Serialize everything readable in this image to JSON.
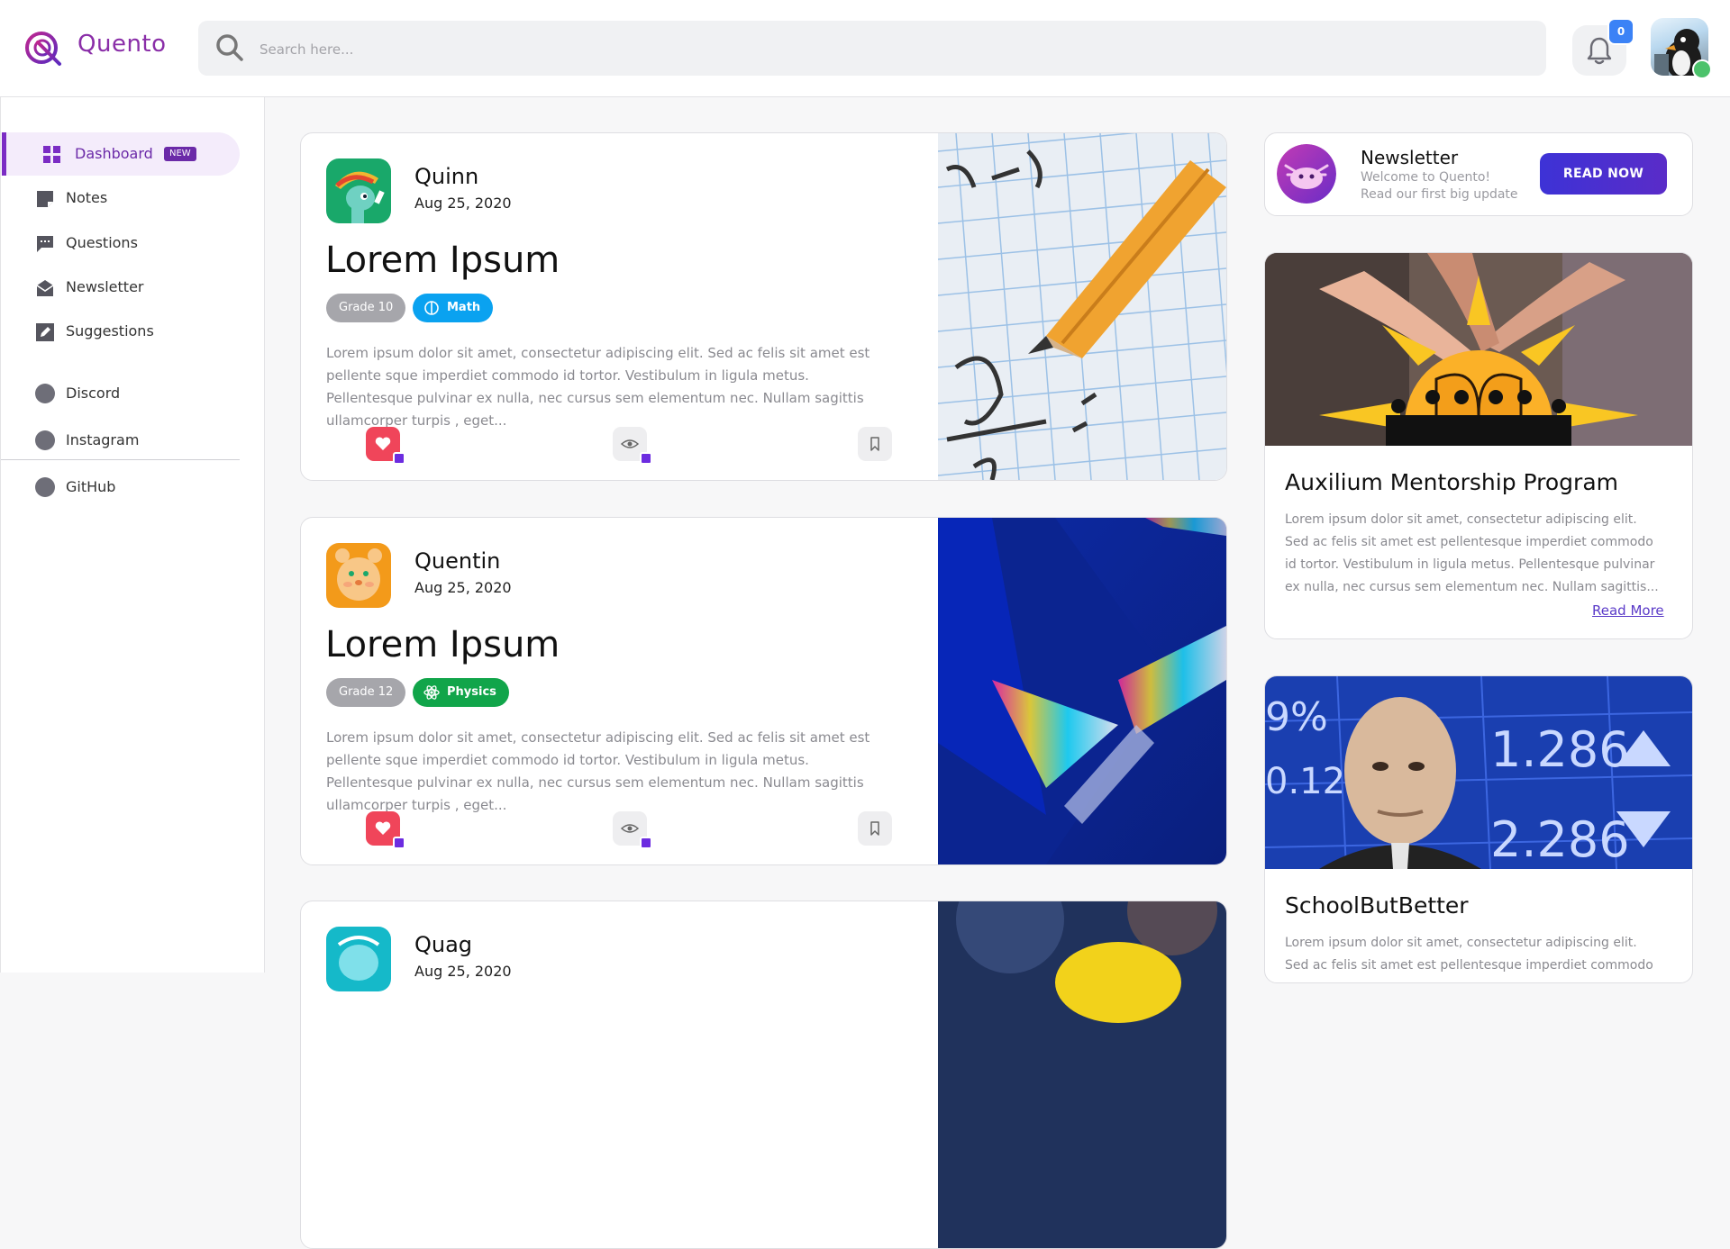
{
  "app": {
    "name": "Quento",
    "brand_color": "#8a2ea8",
    "search_placeholder": "Search here...",
    "notification_count": "0"
  },
  "sidebar": {
    "items": [
      {
        "label": "Dashboard",
        "icon": "dashboard-grid-icon",
        "badge": "NEW",
        "active": true
      },
      {
        "label": "Notes",
        "icon": "note-icon"
      },
      {
        "label": "Questions",
        "icon": "chat-bubble-icon"
      },
      {
        "label": "Newsletter",
        "icon": "mail-icon"
      },
      {
        "label": "Suggestions",
        "icon": "edit-icon"
      }
    ],
    "social": [
      {
        "label": "Discord",
        "icon": "discord-icon"
      },
      {
        "label": "Instagram",
        "icon": "instagram-icon"
      },
      {
        "label": "GitHub",
        "icon": "github-icon"
      }
    ]
  },
  "posts": [
    {
      "author": "Quinn",
      "date": "Aug 25, 2020",
      "title": "Lorem Ipsum",
      "grade": "Grade 10",
      "subject": "Math",
      "subject_color": "#0aa2f0",
      "body": "Lorem ipsum dolor sit amet, consectetur adipiscing elit. Sed ac felis sit amet est pellente sque imperdiet commodo id tortor. Vestibulum in ligula metus. Pellentesque pulvinar ex nulla, nec cursus sem elementum nec. Nullam sagittis ullamcorper turpis , eget..."
    },
    {
      "author": "Quentin",
      "date": "Aug 25, 2020",
      "title": "Lorem Ipsum",
      "grade": "Grade 12",
      "subject": "Physics",
      "subject_color": "#11a54a",
      "body": "Lorem ipsum dolor sit amet, consectetur adipiscing elit. Sed ac felis sit amet est pellente sque imperdiet commodo id tortor. Vestibulum in ligula metus. Pellentesque pulvinar ex nulla, nec cursus sem elementum nec. Nullam sagittis ullamcorper turpis , eget..."
    },
    {
      "author": "Quag",
      "date": "Aug 25, 2020"
    }
  ],
  "newsletter": {
    "title": "Newsletter",
    "line1": "Welcome to Quento!",
    "line2": "Read our first big update",
    "button": "READ NOW"
  },
  "promos": [
    {
      "title": "Auxilium Mentorship Program",
      "body": "Lorem ipsum dolor sit amet, consectetur adipiscing elit. Sed ac felis sit amet est pellentesque imperdiet commodo id tortor. Vestibulum in ligula metus. Pellentesque pulvinar ex nulla, nec cursus sem elementum nec. Nullam sagittis...",
      "link": "Read More"
    },
    {
      "title": "SchoolButBetter",
      "body": "Lorem ipsum dolor sit amet, consectetur adipiscing elit. Sed ac felis sit amet est pellentesque imperdiet commodo",
      "image_text": {
        "pct1": "9%",
        "pct2": "0.12%",
        "num1": "1.286",
        "num2": "2.286"
      }
    }
  ]
}
